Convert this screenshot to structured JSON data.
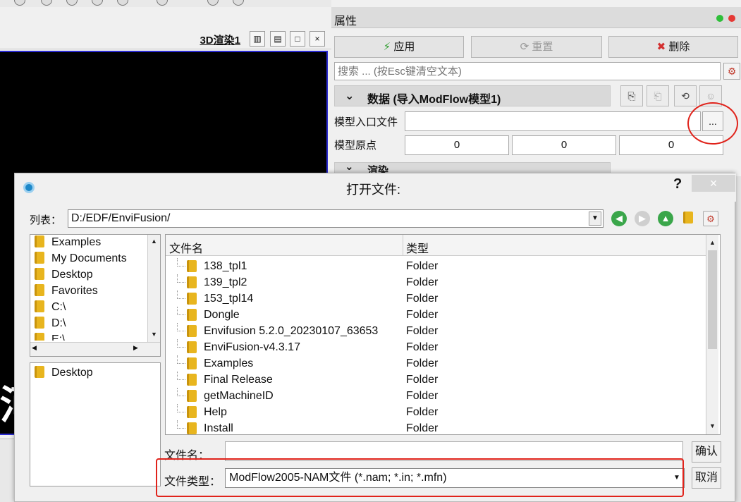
{
  "render_view": {
    "title": "3D渲染1",
    "buttons": [
      "▥",
      "▤",
      "□",
      "×"
    ],
    "canvas_glyph": "河"
  },
  "properties": {
    "title": "属性",
    "apply_label": "应用",
    "reset_label": "重置",
    "delete_label": "删除",
    "search_placeholder": "搜索 ... (按Esc键清空文本)",
    "data_section_label": "数据 (导入ModFlow模型1)",
    "render_section_label": "渲染",
    "model_file_label": "模型入口文件",
    "model_file_value": "",
    "browse_label": "...",
    "model_origin_label": "模型原点",
    "origin_values": [
      "0",
      "0",
      "0"
    ]
  },
  "dialog": {
    "title": "打开文件:",
    "help": "?",
    "close": "×",
    "look_in_label": "列表：",
    "look_in_value": "D:/EDF/EnviFusion/",
    "sidebar_top": [
      "Examples",
      "My Documents",
      "Desktop",
      "Favorites",
      "C:\\",
      "D:\\",
      "E:\\"
    ],
    "sidebar_bottom": [
      "Desktop"
    ],
    "columns": {
      "name": "文件名",
      "type": "类型"
    },
    "files": [
      {
        "name": "138_tpl1",
        "type": "Folder"
      },
      {
        "name": "139_tpl2",
        "type": "Folder"
      },
      {
        "name": "153_tpl14",
        "type": "Folder"
      },
      {
        "name": "Dongle",
        "type": "Folder"
      },
      {
        "name": "Envifusion 5.2.0_20230107_63653",
        "type": "Folder"
      },
      {
        "name": "EnviFusion-v4.3.17",
        "type": "Folder"
      },
      {
        "name": "Examples",
        "type": "Folder"
      },
      {
        "name": "Final Release",
        "type": "Folder"
      },
      {
        "name": "getMachineID",
        "type": "Folder"
      },
      {
        "name": "Help",
        "type": "Folder"
      },
      {
        "name": "Install",
        "type": "Folder"
      }
    ],
    "file_name_label": "文件名：",
    "file_name_value": "",
    "file_type_label": "文件类型：",
    "file_type_value": "ModFlow2005-NAM文件 (*.nam; *.in; *.mfn)",
    "ok_label": "确认",
    "cancel_label": "取消"
  },
  "colors": {
    "annotation": "#e0231b",
    "apply_icon": "#2e9e2e",
    "delete_icon": "#d32f2f"
  }
}
